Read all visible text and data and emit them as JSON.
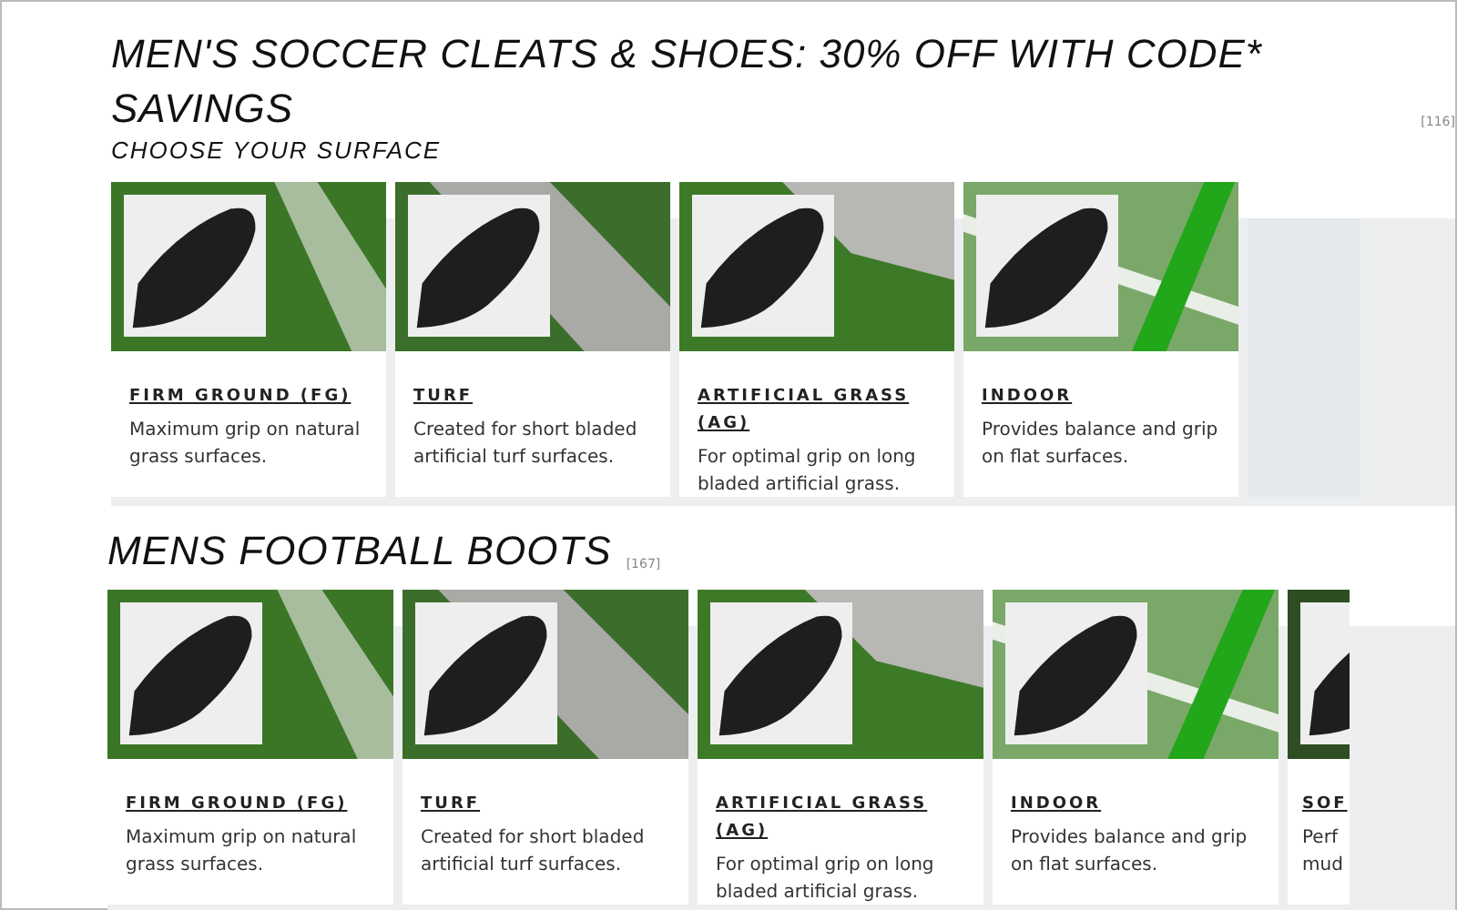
{
  "sections": [
    {
      "title": "MEN'S SOCCER CLEATS & SHOES: 30% OFF WITH CODE* SAVINGS",
      "count": "[116]",
      "subtitle": "CHOOSE YOUR SURFACE",
      "cards": [
        {
          "kind": "natural-grass",
          "title": "FIRM GROUND (FG)",
          "description": "Maximum grip on natural grass surfaces."
        },
        {
          "kind": "turf",
          "title": "TURF",
          "description": "Created for short bladed artificial turf surfaces."
        },
        {
          "kind": "artificial-grass",
          "title": "ARTIFICIAL GRASS (AG)",
          "description": "For optimal grip on long bladed artificial grass."
        },
        {
          "kind": "indoor",
          "title": "INDOOR",
          "description": "Provides balance and grip on flat surfaces."
        }
      ]
    },
    {
      "title": "MENS FOOTBALL BOOTS",
      "count": "[167]",
      "cards": [
        {
          "kind": "natural-grass",
          "title": "FIRM GROUND (FG)",
          "description": "Maximum grip on natural grass surfaces."
        },
        {
          "kind": "turf",
          "title": "TURF",
          "description": "Created for short bladed artificial turf surfaces."
        },
        {
          "kind": "artificial-grass",
          "title": "ARTIFICIAL GRASS (AG)",
          "description": "For optimal grip on long bladed artificial grass."
        },
        {
          "kind": "indoor",
          "title": "INDOOR",
          "description": "Provides balance and grip on flat surfaces."
        },
        {
          "kind": "partial",
          "title": "SOF",
          "description": "Perf mud"
        }
      ]
    }
  ]
}
